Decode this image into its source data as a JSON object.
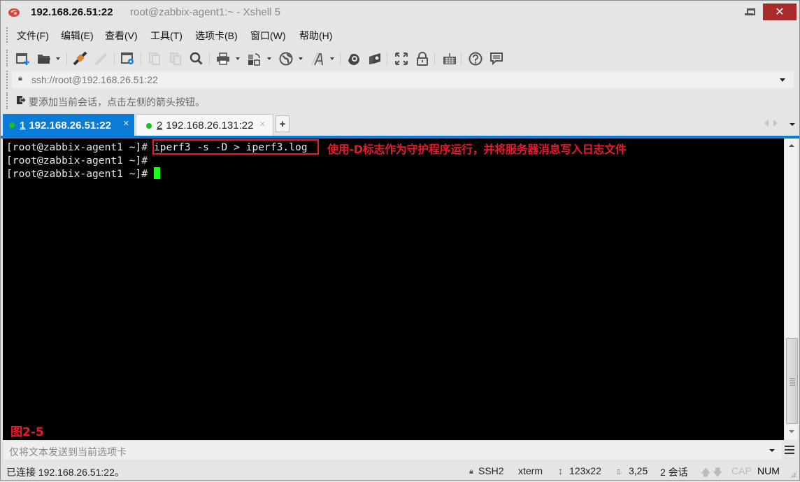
{
  "window": {
    "host": "192.168.26.51:22",
    "subtitle": "root@zabbix-agent1:~ - Xshell 5",
    "close_glyph": "✕"
  },
  "menu": [
    {
      "label": "文件(F)"
    },
    {
      "label": "编辑(E)"
    },
    {
      "label": "查看(V)"
    },
    {
      "label": "工具(T)"
    },
    {
      "label": "选项卡(B)"
    },
    {
      "label": "窗口(W)"
    },
    {
      "label": "帮助(H)"
    }
  ],
  "toolbar": {
    "icons": [
      "new-session-icon",
      "open-folder-icon",
      "connect-icon",
      "disconnect-icon",
      "properties-icon",
      "copy-icon",
      "paste-icon",
      "find-icon",
      "print-icon",
      "transfer-icon",
      "globe-icon",
      "font-icon",
      "xftp-icon",
      "xmanager-icon",
      "fullscreen-icon",
      "lock-icon",
      "keyboard-icon",
      "help-icon",
      "chat-icon"
    ]
  },
  "address": {
    "value": "ssh://root@192.168.26.51:22"
  },
  "hint": {
    "text": "要添加当前会话，点击左侧的箭头按钮。"
  },
  "tabs": [
    {
      "num": "1",
      "label": "192.168.26.51:22",
      "active": true,
      "status_color": "#1bc21b"
    },
    {
      "num": "2",
      "label": "192.168.26.131:22",
      "active": false,
      "status_color": "#1bc21b"
    }
  ],
  "tab_add_label": "+",
  "terminal": {
    "lines": [
      {
        "prompt": "[root@zabbix-agent1 ~]# ",
        "command": "iperf3 -s -D > iperf3.log"
      },
      {
        "prompt": "[root@zabbix-agent1 ~]# ",
        "command": ""
      },
      {
        "prompt": "[root@zabbix-agent1 ~]# ",
        "command": ""
      }
    ],
    "annotation": "使用-D标志作为守护程序运行，并将服务器消息写入日志文件",
    "figure_label": "图2-5",
    "cursor_color": "#19ff19",
    "highlight_color": "#e8192c"
  },
  "compose": {
    "placeholder": "仅将文本发送到当前选项卡"
  },
  "status": {
    "connection": "已连接 192.168.26.51:22。",
    "protocol": "SSH2",
    "terminal_type": "xterm",
    "size": "123x22",
    "cursor_pos": "3,25",
    "sessions": "2 会话",
    "cap": "CAP",
    "num": "NUM"
  },
  "colors": {
    "accent": "#0a7bd6",
    "close_button": "#a82a2a"
  }
}
